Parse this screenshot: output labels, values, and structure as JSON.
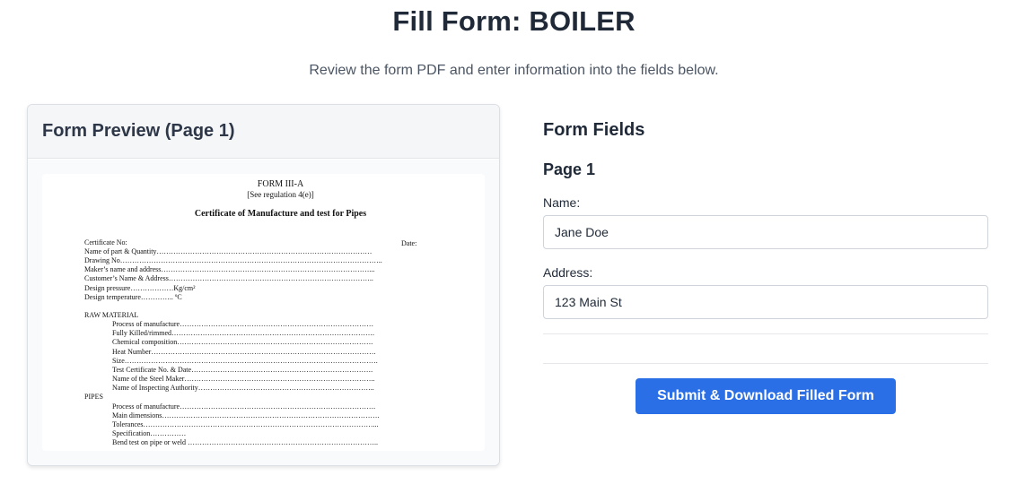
{
  "page": {
    "title": "Fill Form: BOILER",
    "subtitle": "Review the form PDF and enter information into the fields below."
  },
  "preview": {
    "title": "Form Preview (Page 1)",
    "pdf": {
      "form_no": "FORM III-A",
      "regulation": "[See regulation 4(e)]",
      "heading": "Certificate of Manufacture and test for Pipes",
      "date_label": "Date:",
      "lines": [
        "Certificate No:",
        "Name of part & Quantity………………………………………………………………………………",
        "Drawing No………………………………………………………………………………………………..",
        "Maker’s name and address……………………………………………………………………………...",
        "Customer’s Name & Address…………………………………………………………………………..",
        "Design pressure………………Kg/cm²",
        "Design temperature………….. ºC",
        "RAW MATERIAL",
        "Process of manufacture………………………………………………………………………",
        "Fully Killed/rimmed………………………………………………………………………….",
        "Chemical composition……………………………………………………………………….",
        "Heat Number………………………………………………………………………………….",
        "Size…………………………………………………………………………………………….",
        "Test Certificate No. & Date………………………………………………………………….",
        "Name of the Steel Maker……………………………………………………………………..",
        "Name of Inspecting Authority………………………………………………………………..",
        "PIPES",
        "Process of manufacture……………………………………………………………………….",
        "Main dimensions……………………………………………………………………………….",
        "Tolerances……………………………………………………………………………………...",
        "Specification……………",
        "Bend test on pipe or weld …………………………………………………………………….."
      ]
    }
  },
  "form": {
    "heading": "Form Fields",
    "page_heading": "Page 1",
    "name_label": "Name:",
    "name_value": "Jane Doe",
    "address_label": "Address:",
    "address_value": "123 Main St",
    "submit_label": "Submit & Download Filled Form"
  }
}
